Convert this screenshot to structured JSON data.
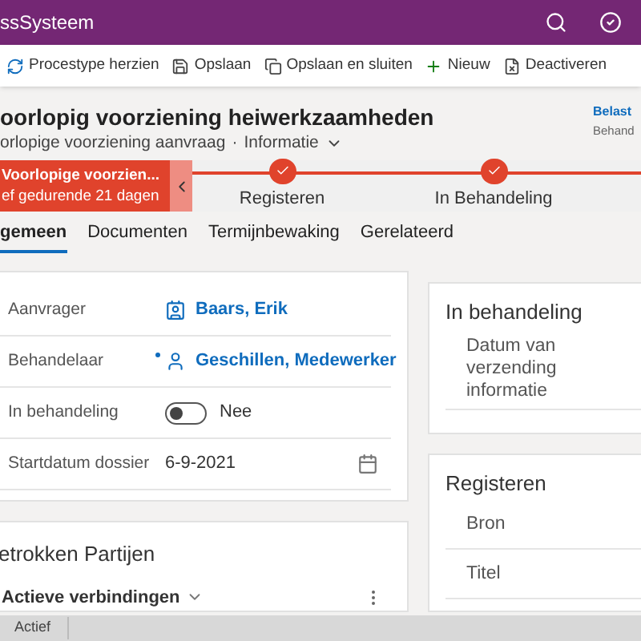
{
  "app_bar": {
    "title": "ssSysteem"
  },
  "commands": [
    {
      "kind": "refresh",
      "label": "Procestype herzien"
    },
    {
      "kind": "save",
      "label": "Opslaan"
    },
    {
      "kind": "saveclose",
      "label": "Opslaan en sluiten"
    },
    {
      "kind": "new",
      "label": "Nieuw"
    },
    {
      "kind": "deactivate",
      "label": "Deactiveren"
    }
  ],
  "header": {
    "title": "oorlopig voorziening heiwerkzaamheden",
    "entity": "orlopige voorziening aanvraag",
    "separator": "·",
    "form": "Informatie",
    "side_link": "Belast",
    "side_label": "Behand"
  },
  "process": {
    "active_stage": {
      "name": "Voorlopige voorzien...",
      "duration": "ef gedurende 21 dagen"
    },
    "stages": [
      {
        "label": "Registeren",
        "done": true
      },
      {
        "label": "In Behandeling",
        "done": true
      }
    ]
  },
  "tabs": [
    {
      "label": "gemeen",
      "selected": true
    },
    {
      "label": "Documenten",
      "selected": false
    },
    {
      "label": "Termijnbewaking",
      "selected": false
    },
    {
      "label": "Gerelateerd",
      "selected": false
    }
  ],
  "fields": [
    {
      "kind": "lookup",
      "label": "Aanvrager",
      "value": "Baars, Erik",
      "required": false
    },
    {
      "kind": "lookup",
      "label": "Behandelaar",
      "value": "Geschillen, Medewerker",
      "required": true
    },
    {
      "kind": "toggle",
      "label": "In behandeling",
      "on": false,
      "value": "Nee"
    },
    {
      "kind": "date",
      "label": "Startdatum dossier",
      "value": "6-9-2021"
    }
  ],
  "related": {
    "title": "etrokken Partijen",
    "view": "Actieve verbindingen"
  },
  "side_sections": [
    {
      "title": "In behandeling",
      "fields": [
        "Datum van verzending informatie"
      ]
    },
    {
      "title": "Registeren",
      "fields": [
        "Bron",
        "Titel"
      ]
    }
  ],
  "status_bar": {
    "status": "Actief"
  }
}
